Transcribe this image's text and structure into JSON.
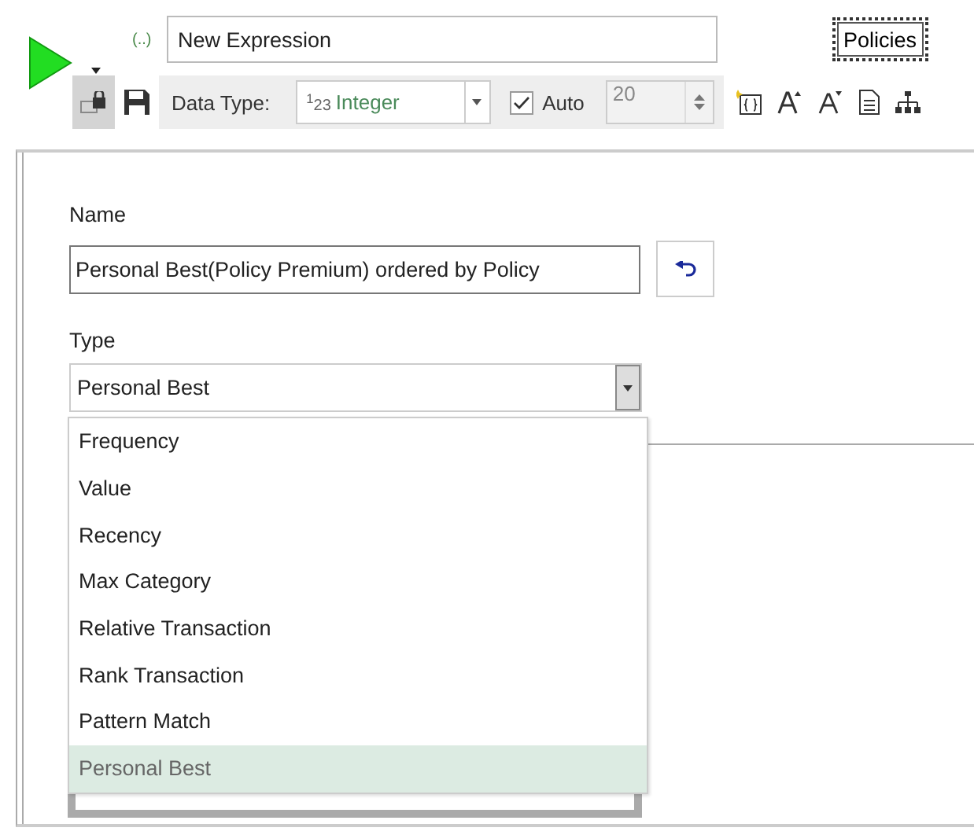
{
  "toolbar": {
    "expression_marker": "(..)",
    "expression": "New Expression",
    "table_button": "Policies",
    "lock_pressed": true,
    "data_type_label": "Data Type:",
    "data_type_badge": "$^{1}$23",
    "data_type": "Integer",
    "auto": {
      "label": "Auto",
      "checked": true
    },
    "size": "20"
  },
  "form": {
    "name_label": "Name",
    "name_value": "Personal Best(Policy Premium) ordered by Policy",
    "type_label": "Type",
    "type_value": "Personal Best",
    "type_options": [
      {
        "label": "Frequency",
        "selected": false
      },
      {
        "label": "Value",
        "selected": false
      },
      {
        "label": "Recency",
        "selected": false
      },
      {
        "label": "Max Category",
        "selected": false
      },
      {
        "label": "Relative Transaction",
        "selected": false
      },
      {
        "label": "Rank Transaction",
        "selected": false
      },
      {
        "label": "Pattern Match",
        "selected": false
      },
      {
        "label": "Personal Best",
        "selected": true
      }
    ]
  }
}
